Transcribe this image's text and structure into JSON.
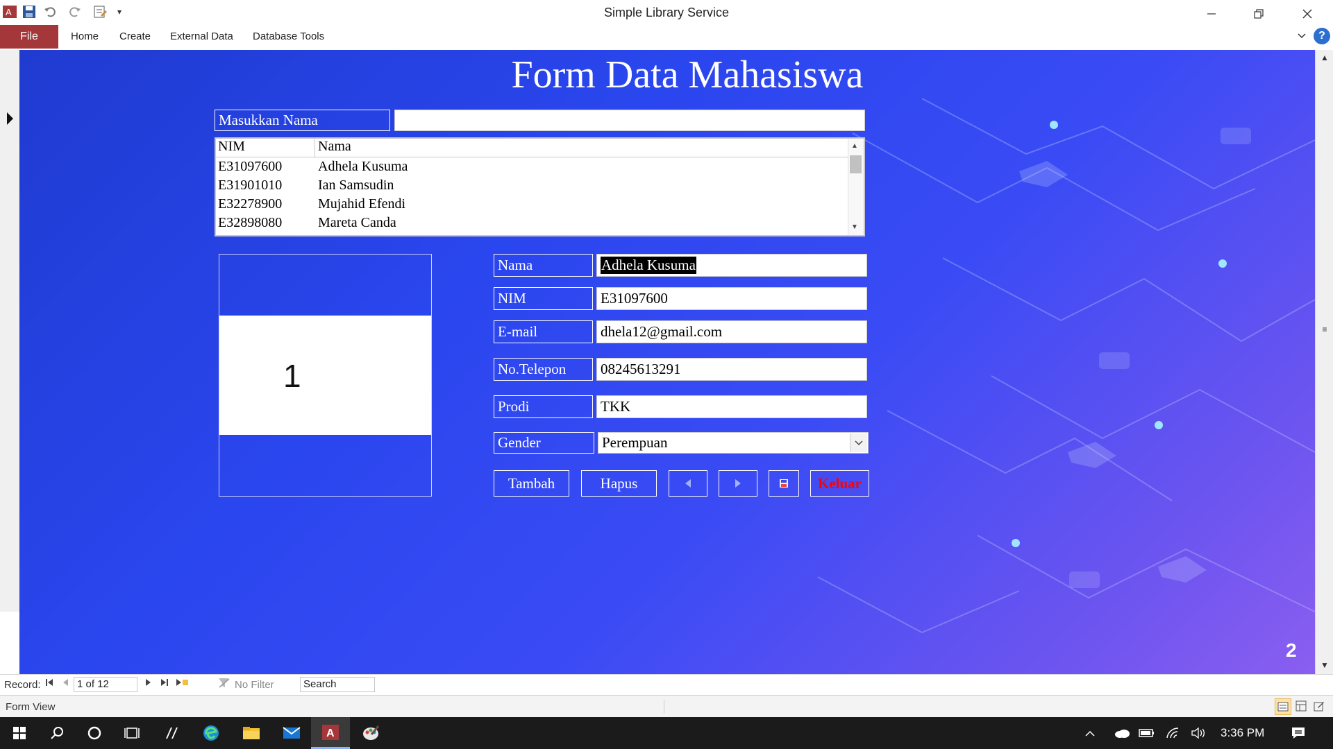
{
  "window": {
    "title": "Simple Library Service",
    "controls": [
      "minimize",
      "restore",
      "close"
    ]
  },
  "ribbon": {
    "file_label": "File",
    "tabs": [
      {
        "label": "Home"
      },
      {
        "label": "Create"
      },
      {
        "label": "External Data"
      },
      {
        "label": "Database Tools"
      }
    ],
    "help_label": "?"
  },
  "form": {
    "title": "Form Data Mahasiswa",
    "search_label": "Masukkan Nama",
    "search_value": "",
    "list": {
      "headers": [
        "NIM",
        "Nama"
      ],
      "rows": [
        [
          "E31097600",
          "Adhela Kusuma"
        ],
        [
          "E31901010",
          "Ian Samsudin"
        ],
        [
          "E32278900",
          "Mujahid Efendi"
        ],
        [
          "E32898080",
          "Mareta Canda"
        ]
      ]
    },
    "photo_number": "1",
    "fields": [
      {
        "label": "Nama",
        "value": "Adhela Kusuma"
      },
      {
        "label": "NIM",
        "value": "E31097600"
      },
      {
        "label": "E-mail",
        "value": "dhela12@gmail.com"
      },
      {
        "label": "No.Telepon",
        "value": "08245613291"
      },
      {
        "label": "Prodi",
        "value": "TKK"
      },
      {
        "label": "Gender",
        "value": "Perempuan"
      }
    ],
    "buttons": {
      "tambah": "Tambah",
      "hapus": "Hapus",
      "keluar": "Keluar"
    },
    "keluar_color": "#ff0000",
    "page_number": "2"
  },
  "record_nav": {
    "label": "Record:",
    "current": "1 of 12",
    "filter": "No Filter",
    "search": "Search"
  },
  "status": {
    "view": "Form View"
  },
  "taskbar": {
    "time": "3:36 PM"
  },
  "colors": {
    "file_tab": "#a4373a",
    "form_bg_start": "#1f3bd0",
    "form_bg_end": "#8a5ef0"
  }
}
